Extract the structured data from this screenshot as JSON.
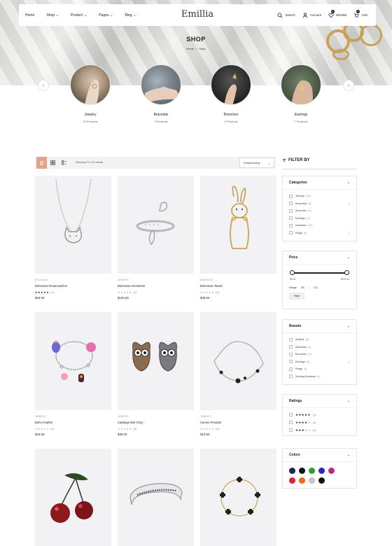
{
  "header": {
    "logo": "Emillia",
    "nav": [
      "Home",
      "Shop",
      "Product",
      "Pages",
      "Blog"
    ],
    "search_label": "Search",
    "account_label": "Account",
    "wishlist_label": "Wishlist",
    "wishlist_count": "0",
    "cart_label": "Cart",
    "cart_count": "0"
  },
  "page": {
    "title": "SHOP",
    "breadcrumb_home": "Home",
    "breadcrumb_sep": "/",
    "breadcrumb_current": "Shop"
  },
  "categories": [
    {
      "name": "Jewelry",
      "count": "19 Products"
    },
    {
      "name": "Bracelets",
      "count": "3 Products"
    },
    {
      "name": "Brooches",
      "count": "6 Products"
    },
    {
      "name": "Earrings",
      "count": "7 Products"
    }
  ],
  "toolbar": {
    "result_count": "Showing 10 of 20 results",
    "sort_label": "Default sorting"
  },
  "products": [
    {
      "vendor": "ERCOLANO",
      "name": "Bohemian Dreamcatcher",
      "stars": 5,
      "reviews": "(1)",
      "price": "$18.00"
    },
    {
      "vendor": "JEWELRY",
      "name": "Bohemian Gemstone",
      "stars": 0,
      "reviews": "(0)",
      "price": "$130.00"
    },
    {
      "vendor": "BOHOCHIC",
      "name": "Bohemian Tassel",
      "stars": 0,
      "reviews": "(0)",
      "price": "$38.00"
    },
    {
      "vendor": "JEWELRY",
      "name": "Boho Feather",
      "stars": 0,
      "reviews": "(0)",
      "price": "$18.00"
    },
    {
      "vendor": "JEWELRY",
      "name": "Cabbage Bok Choy",
      "stars": 0,
      "reviews": "(0)",
      "price": "$36.00"
    },
    {
      "vendor": "JEWELRY",
      "name": "Cameo Pendant",
      "stars": 0,
      "reviews": "(0)",
      "price": "$13.50"
    },
    {
      "vendor": "",
      "name": "",
      "stars": 0,
      "reviews": "",
      "price": ""
    },
    {
      "vendor": "",
      "name": "",
      "stars": 0,
      "reviews": "",
      "price": ""
    },
    {
      "vendor": "",
      "name": "",
      "stars": 0,
      "reviews": "",
      "price": ""
    }
  ],
  "sidebar": {
    "filter_title": "FILTER BY",
    "categories_title": "Categories",
    "categories": [
      {
        "label": "Jewelry",
        "count": "(19)",
        "expand": false
      },
      {
        "label": "Bracelets",
        "count": "(3)",
        "expand": true
      },
      {
        "label": "Brooches",
        "count": "(6)",
        "expand": false
      },
      {
        "label": "Earrings",
        "count": "(7)",
        "expand": false
      },
      {
        "label": "Necklace",
        "count": "(12)",
        "expand": false
      },
      {
        "label": "Rings",
        "count": "(4)",
        "expand": true
      }
    ],
    "price_title": "Price",
    "price_min": "$0.00",
    "price_max": "$131.00",
    "price_range_label": "Range:",
    "price_from": "$0",
    "price_dash": "-",
    "price_to": "131",
    "filter_button": "Filter",
    "brands_title": "Brands",
    "brands": [
      {
        "label": "Anklets",
        "count": "(5)",
        "expand": false
      },
      {
        "label": "Bracelets",
        "count": "(5)",
        "expand": false
      },
      {
        "label": "Brooches",
        "count": "(5)",
        "expand": false
      },
      {
        "label": "Earrings",
        "count": "(4)",
        "expand": true
      },
      {
        "label": "Rings",
        "count": "(4)",
        "expand": false
      },
      {
        "label": "Sterling Rainbow",
        "count": "(2)",
        "expand": false
      }
    ],
    "ratings_title": "Ratings",
    "ratings": [
      {
        "stars": 5,
        "count": "(1)"
      },
      {
        "stars": 4,
        "count": "(0)"
      },
      {
        "stars": 3,
        "count": "(0)"
      }
    ],
    "colors_title": "Colors",
    "colors": [
      "#1a2a4a",
      "#111111",
      "#2ca02c",
      "#2a2ab8",
      "#c0267e",
      "#e0203a",
      "#f06a1c",
      "#c8c8c8",
      "#111111"
    ]
  }
}
